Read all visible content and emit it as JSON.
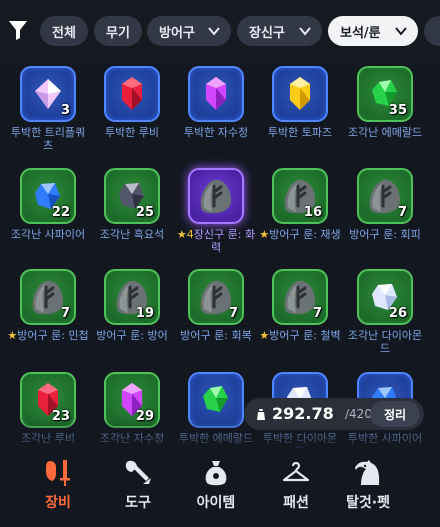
{
  "filters": {
    "all": "전체",
    "weapon": "무기",
    "armor": "방어구",
    "accessory": "장신구",
    "gem_rune": "보석/룬"
  },
  "items": [
    {
      "name": "투박한 트리플쿼츠",
      "count": "3",
      "frame": "blue",
      "icon": "triple-quartz-icon"
    },
    {
      "name": "투박한 루비",
      "count": "",
      "frame": "blue",
      "icon": "ruby-icon"
    },
    {
      "name": "투박한 자수정",
      "count": "",
      "frame": "blue",
      "icon": "amethyst-icon"
    },
    {
      "name": "투박한 토파즈",
      "count": "",
      "frame": "blue",
      "icon": "topaz-icon"
    },
    {
      "name": "조각난 에메랄드",
      "count": "35",
      "frame": "green",
      "icon": "emerald-icon"
    },
    {
      "name": "조각난 사파이어",
      "count": "22",
      "frame": "green",
      "icon": "sapphire-icon"
    },
    {
      "name": "조각난 흑요석",
      "count": "25",
      "frame": "green",
      "icon": "obsidian-icon"
    },
    {
      "name": "장신구 룬: 화력",
      "star": "★4",
      "count": "",
      "frame": "purple",
      "icon": "rune-stone-icon"
    },
    {
      "name": "방어구 룬: 재생",
      "star": "★",
      "count": "16",
      "frame": "green",
      "icon": "rune-stone-icon"
    },
    {
      "name": "방어구 룬: 회피",
      "count": "7",
      "frame": "green",
      "icon": "rune-stone-icon"
    },
    {
      "name": "방어구 룬: 민첩",
      "star": "★",
      "count": "7",
      "frame": "green",
      "icon": "rune-stone-icon"
    },
    {
      "name": "방어구 룬: 방어",
      "count": "19",
      "frame": "green",
      "icon": "rune-stone-icon"
    },
    {
      "name": "방어구 룬: 회복",
      "count": "7",
      "frame": "green",
      "icon": "rune-stone-icon"
    },
    {
      "name": "방어구 룬: 철벽",
      "star": "★",
      "count": "7",
      "frame": "green",
      "icon": "rune-stone-icon"
    },
    {
      "name": "조각난 다이아몬드",
      "count": "26",
      "frame": "green",
      "icon": "diamond-icon"
    },
    {
      "name": "조각난 루비",
      "count": "23",
      "frame": "green",
      "icon": "ruby-icon"
    },
    {
      "name": "조각난 자수정",
      "count": "29",
      "frame": "green",
      "icon": "amethyst-icon"
    },
    {
      "name": "투박한 에메랄드",
      "count": "",
      "frame": "blue",
      "icon": "emerald-icon"
    },
    {
      "name": "투박한 다이아몬드",
      "count": "",
      "frame": "blue",
      "icon": "diamond-icon"
    },
    {
      "name": "투박한 사파이어",
      "count": "",
      "frame": "blue",
      "icon": "sapphire-icon"
    }
  ],
  "weight": {
    "current": "292.78",
    "max": "/420"
  },
  "sort_label": "정리",
  "nav": {
    "equipment": "장비",
    "tools": "도구",
    "items": "아이템",
    "fashion": "패션",
    "mounts": "탈것·펫"
  },
  "colors": {
    "accent": "#ff6a3c",
    "blue_frame": "#4f86ff",
    "green_frame": "#4fc05a",
    "purple_frame": "#a779ff"
  }
}
